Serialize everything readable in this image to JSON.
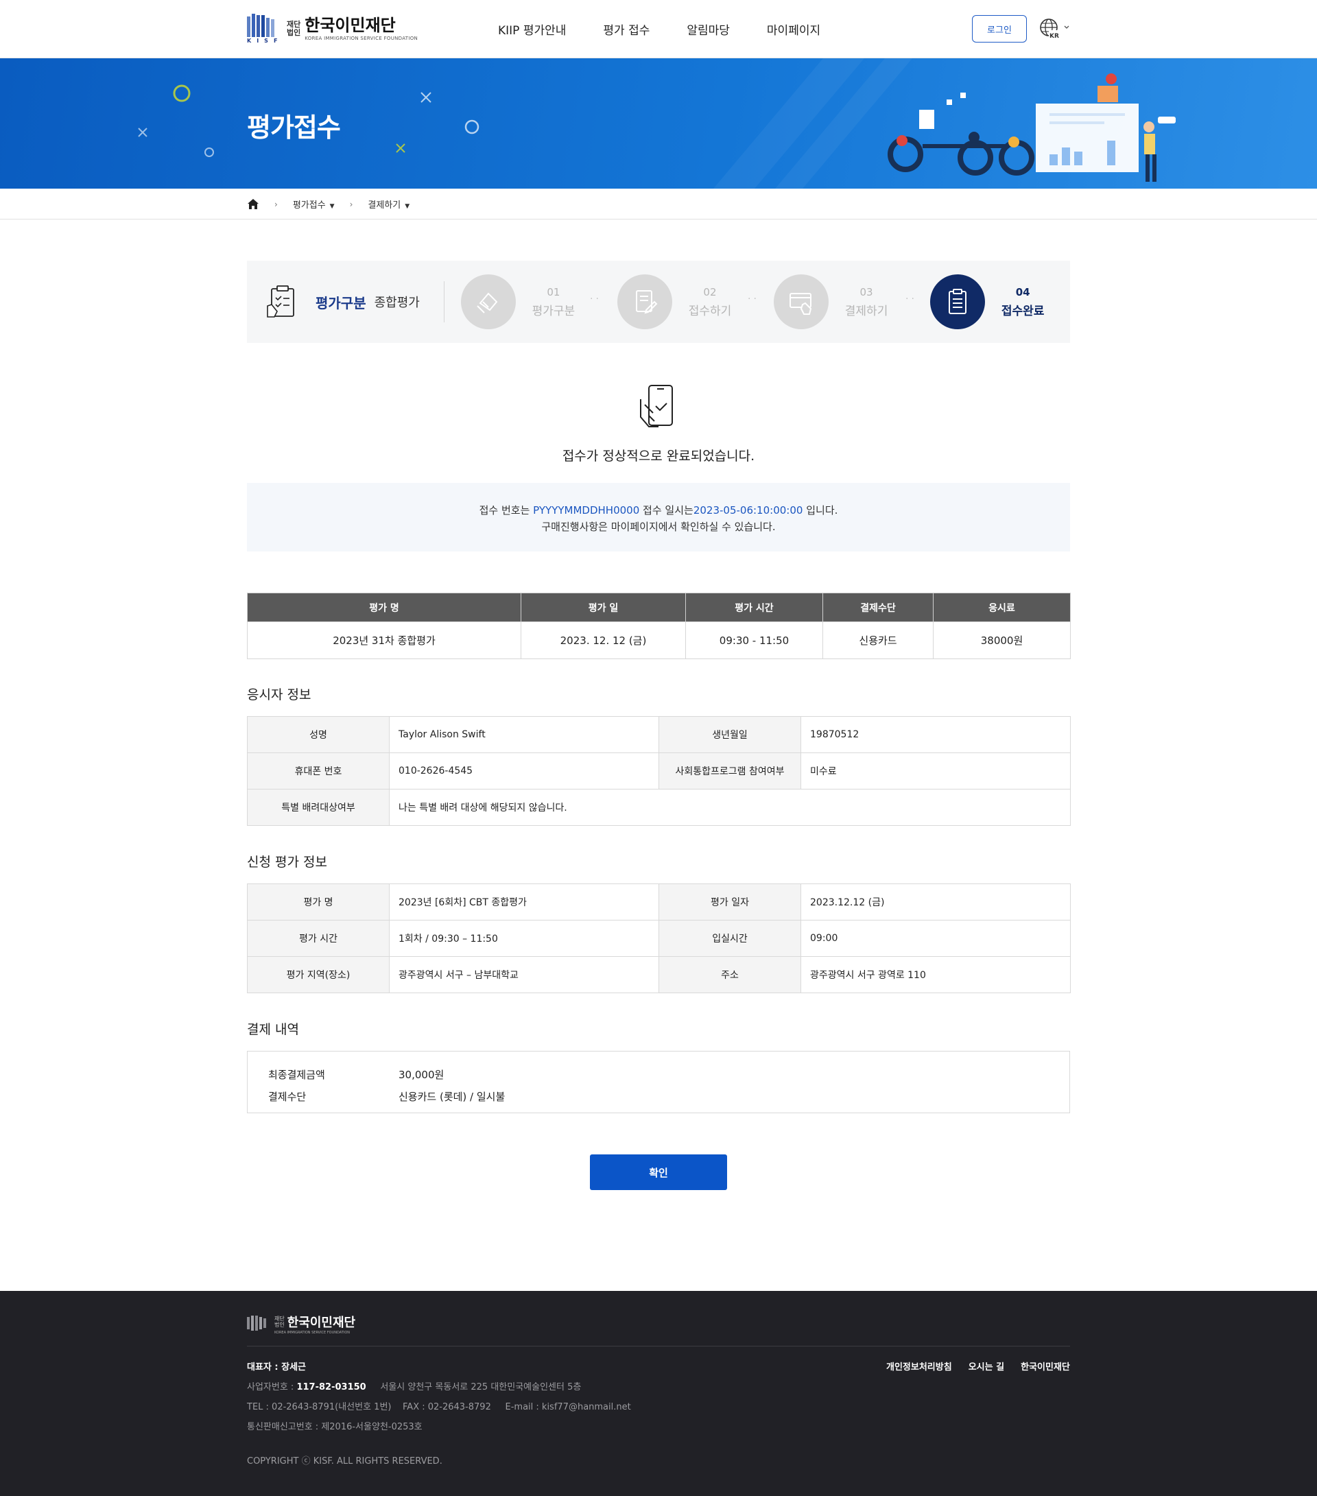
{
  "header": {
    "logo_small_1": "재단",
    "logo_small_2": "법인",
    "logo_name": "한국이민재단",
    "logo_sub": "KOREA IMMIGRATION SERVICE FOUNDATION",
    "logo_mark_text": "KISF",
    "nav": [
      "KIIP 평가안내",
      "평가 접수",
      "알림마당",
      "마이페이지"
    ],
    "login_label": "로그인",
    "lang": "KR"
  },
  "banner": {
    "title": "평가접수"
  },
  "breadcrumb": {
    "level1": "평가접수",
    "level2": "결제하기"
  },
  "steps": {
    "category_label": "평가구분",
    "category_value": "종합평가",
    "items": [
      {
        "num": "01",
        "name": "평가구분"
      },
      {
        "num": "02",
        "name": "접수하기"
      },
      {
        "num": "03",
        "name": "결제하기"
      },
      {
        "num": "04",
        "name": "접수완료"
      }
    ]
  },
  "complete": {
    "message": "접수가 정상적으로 완료되었습니다.",
    "notice_prefix": "접수 번호는",
    "receipt_no": "PYYYYMMDDHH0000",
    "notice_mid": "접수 일시는",
    "receipt_time": "2023-05-06:10:00:00",
    "notice_suffix": "입니다.",
    "notice_line2": "구매진행사항은 마이페이지에서 확인하실 수 있습니다."
  },
  "summary_table": {
    "headers": [
      "평가 명",
      "평가 일",
      "평가 시간",
      "결제수단",
      "응시료"
    ],
    "row": [
      "2023년 31차 종합평가",
      "2023. 12. 12 (금)",
      "09:30 - 11:50",
      "신용카드",
      "38000원"
    ]
  },
  "applicant": {
    "title": "응시자 정보",
    "name_label": "성명",
    "name": "Taylor Alison Swift",
    "birth_label": "생년월일",
    "birth": "19870512",
    "phone_label": "휴대폰 번호",
    "phone": "010-2626-4545",
    "program_label": "사회통합프로그램 참여여부",
    "program": "미수료",
    "special_label": "특별 배려대상여부",
    "special": "나는 특별 배려 대상에 해당되지 않습니다."
  },
  "exam_info": {
    "title": "신청 평가 정보",
    "name_label": "평가 명",
    "name": "2023년 [6회차] CBT 종합평가",
    "date_label": "평가 일자",
    "date": "2023.12.12 (금)",
    "time_label": "평가 시간",
    "time": "1회차 / 09:30 – 11:50",
    "entry_label": "입실시간",
    "entry": "09:00",
    "place_label": "평가 지역(장소)",
    "place": "광주광역시 서구 – 남부대학교",
    "addr_label": "주소",
    "addr": "광주광역시 서구 광역로 110"
  },
  "payment": {
    "title": "결제 내역",
    "amount_label": "최종결제금액",
    "amount": "30,000원",
    "method_label": "결제수단",
    "method": "신용카드 (롯데) / 일시불"
  },
  "confirm_label": "확인",
  "footer": {
    "ceo": "대표자 : 장세근",
    "biz_label": "사업자번호 :",
    "biz_no": "117-82-03150",
    "address": "서울시 양천구 목동서로 225 대한민국예술인센터 5층",
    "tel": "TEL : 02-2643-8791(내선번호 1번)",
    "fax": "FAX : 02-2643-8792",
    "email": "E-mail : kisf77@hanmail.net",
    "mail_order": "통신판매신고번호 : 제2016-서울양천-0253호",
    "copyright": "COPYRIGHT ⓒ KISF. ALL RIGHTS RESERVED.",
    "links": [
      "개인정보처리방침",
      "오시는 길",
      "한국이민재단"
    ]
  },
  "colors": {
    "primary": "#0b55c8",
    "navy": "#102a66",
    "banner": "#1476d6",
    "footer": "#212126"
  }
}
